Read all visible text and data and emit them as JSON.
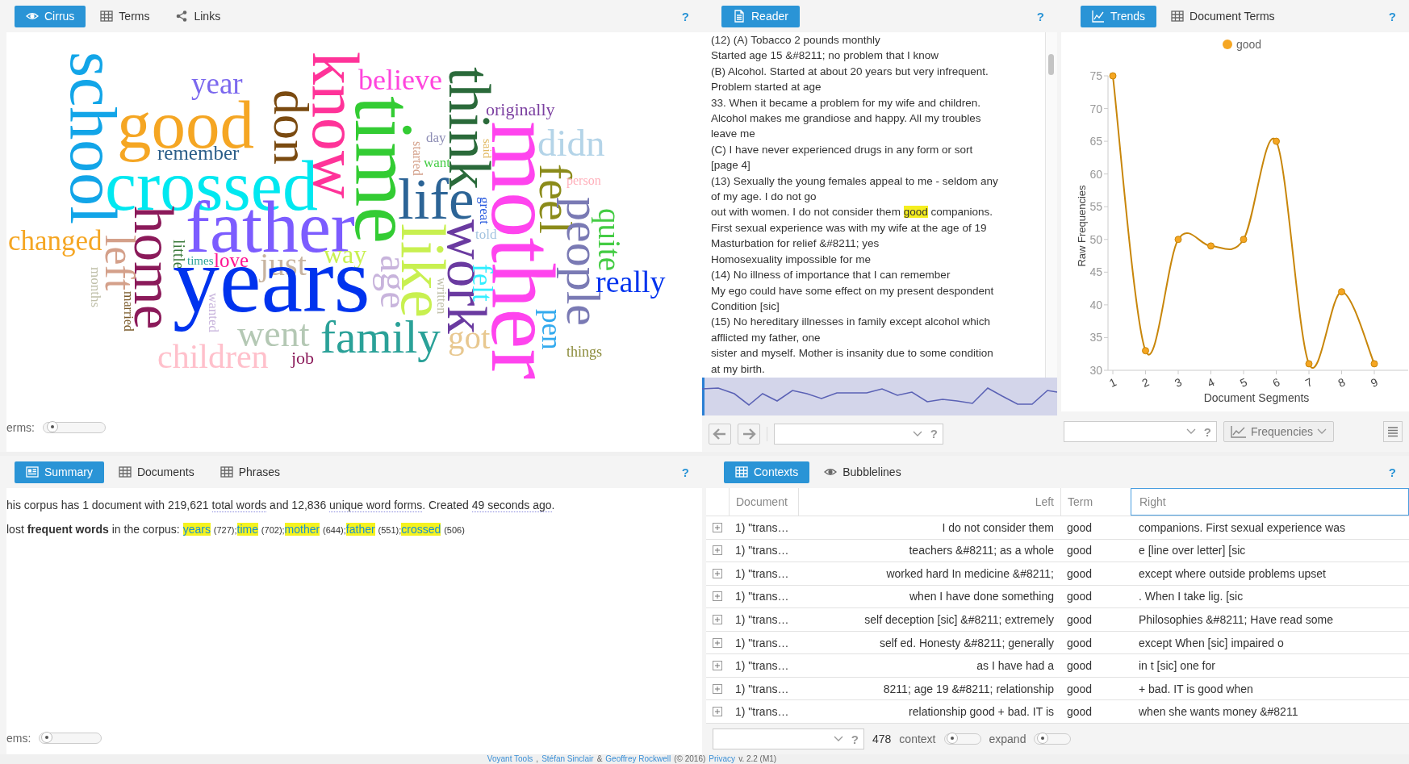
{
  "panels": {
    "cirrus": {
      "tabs": [
        {
          "label": "Cirrus",
          "selected": true
        },
        {
          "label": "Terms",
          "selected": false
        },
        {
          "label": "Links",
          "selected": false
        }
      ],
      "help": "?",
      "words": [
        {
          "text": "school",
          "color": "#12a5e8",
          "vertical": true
        },
        {
          "text": "know",
          "color": "#ff3399",
          "vertical": true
        },
        {
          "text": "think",
          "color": "#2a6a3a",
          "vertical": true
        },
        {
          "text": "year",
          "color": "#7b68ee",
          "vertical": false
        },
        {
          "text": "believe",
          "color": "#ff44dd",
          "vertical": false
        },
        {
          "text": "don",
          "color": "#7a4a10",
          "vertical": true
        },
        {
          "text": "time",
          "color": "#33cc33",
          "vertical": true
        },
        {
          "text": "good",
          "color": "#f5a623",
          "vertical": false
        },
        {
          "text": "originally",
          "color": "#7b3fa0",
          "vertical": false
        },
        {
          "text": "mother",
          "color": "#ff44ee",
          "vertical": true
        },
        {
          "text": "day",
          "color": "#8c8cb4",
          "vertical": false
        },
        {
          "text": "said",
          "color": "#e0b860",
          "vertical": true
        },
        {
          "text": "started",
          "color": "#d4a08a",
          "vertical": true
        },
        {
          "text": "remember",
          "color": "#2c5f8a",
          "vertical": false
        },
        {
          "text": "didn",
          "color": "#b4d4e8",
          "vertical": false
        },
        {
          "text": "crossed",
          "color": "#00e8f0",
          "vertical": false
        },
        {
          "text": "want",
          "color": "#44cc44",
          "vertical": false
        },
        {
          "text": "feel",
          "color": "#8b8b1a",
          "vertical": true
        },
        {
          "text": "life",
          "color": "#2c6496",
          "vertical": false
        },
        {
          "text": "person",
          "color": "#ffb0bb",
          "vertical": false
        },
        {
          "text": "great",
          "color": "#2255dd",
          "vertical": true
        },
        {
          "text": "people",
          "color": "#7a7ab4",
          "vertical": true
        },
        {
          "text": "changed",
          "color": "#f5a623",
          "vertical": false
        },
        {
          "text": "father",
          "color": "#7c5cff",
          "vertical": false
        },
        {
          "text": "home",
          "color": "#8b1a5a",
          "vertical": true
        },
        {
          "text": "quite",
          "color": "#44cc44",
          "vertical": true
        },
        {
          "text": "work",
          "color": "#6a3aa0",
          "vertical": true
        },
        {
          "text": "like",
          "color": "#c8f050",
          "vertical": true
        },
        {
          "text": "told",
          "color": "#a4c4e0",
          "vertical": false
        },
        {
          "text": "left",
          "color": "#d4a08a",
          "vertical": true
        },
        {
          "text": "little",
          "color": "#3a7a3a",
          "vertical": true
        },
        {
          "text": "times",
          "color": "#2aa198",
          "vertical": false
        },
        {
          "text": "love",
          "color": "#ff1493",
          "vertical": false
        },
        {
          "text": "just",
          "color": "#c8b4a0",
          "vertical": false
        },
        {
          "text": "way",
          "color": "#c8f050",
          "vertical": false
        },
        {
          "text": "age",
          "color": "#c8b4dc",
          "vertical": true
        },
        {
          "text": "felt",
          "color": "#33eeff",
          "vertical": true
        },
        {
          "text": "months",
          "color": "#c0c0aa",
          "vertical": true
        },
        {
          "text": "years",
          "color": "#0033ee",
          "vertical": false
        },
        {
          "text": "really",
          "color": "#0033ee",
          "vertical": false
        },
        {
          "text": "written",
          "color": "#c0c0aa",
          "vertical": true
        },
        {
          "text": "married",
          "color": "#7a5a2a",
          "vertical": true
        },
        {
          "text": "wanted",
          "color": "#c8b4dc",
          "vertical": true
        },
        {
          "text": "pen",
          "color": "#33aaee",
          "vertical": true
        },
        {
          "text": "children",
          "color": "#ffc0cb",
          "vertical": false
        },
        {
          "text": "went",
          "color": "#b4c8b4",
          "vertical": false
        },
        {
          "text": "job",
          "color": "#8b1a5a",
          "vertical": false
        },
        {
          "text": "family",
          "color": "#2aa198",
          "vertical": false
        },
        {
          "text": "got",
          "color": "#e8c890",
          "vertical": false
        },
        {
          "text": "things",
          "color": "#8b8b3a",
          "vertical": false
        }
      ],
      "slider": {
        "label": "erms:",
        "level": 0.06
      }
    },
    "reader": {
      "tabs": [
        {
          "label": "Reader",
          "selected": true
        }
      ],
      "help": "?",
      "lines": [
        {
          "kind": "text",
          "text": "(12) (A) Tobacco 2 pounds monthly"
        },
        {
          "kind": "text",
          "text": "Started age 15 &#8211; no problem that I know"
        },
        {
          "kind": "text",
          "text": "(B) Alcohol. Started at about 20 years but very infrequent."
        },
        {
          "kind": "text",
          "text": "Problem started at age"
        },
        {
          "kind": "text",
          "text": "33. When it became a problem for my wife and children."
        },
        {
          "kind": "text",
          "text": "Alcohol makes me grandiose and happy. All my troubles"
        },
        {
          "kind": "text",
          "text": "leave me"
        },
        {
          "kind": "text",
          "text": "(C) I have never experienced drugs in any form or sort"
        },
        {
          "kind": "text",
          "text": "[page 4]"
        },
        {
          "kind": "text",
          "text": "(13) Sexually the young females appeal to me - seldom any"
        },
        {
          "kind": "text",
          "text": "of my age. I do not go"
        },
        {
          "kind": "hit",
          "before": "out with women. I do not consider them ",
          "term": "good",
          "after": " companions."
        },
        {
          "kind": "text",
          "text": "First sexual experience was with my wife at the age of 19"
        },
        {
          "kind": "text",
          "text": "Masturbation for relief &#8211; yes"
        },
        {
          "kind": "text",
          "text": "Homosexuality impossible for me"
        },
        {
          "kind": "text",
          "text": "(14) No illness of importance that I can remember"
        },
        {
          "kind": "text",
          "text": "My ego could have some effect on my present despondent"
        },
        {
          "kind": "text",
          "text": "Condition [sic]"
        },
        {
          "kind": "text",
          "text": "(15) No hereditary illnesses in family except alcohol which"
        },
        {
          "kind": "text",
          "text": "afflicted my father, one"
        },
        {
          "kind": "text",
          "text": "sister and myself. Mother is insanity due to some condition"
        },
        {
          "kind": "text",
          "text": "at my birth."
        }
      ],
      "toolbar": {
        "help": "?"
      }
    },
    "trends": {
      "tabs": [
        {
          "label": "Trends",
          "selected": true
        },
        {
          "label": "Document Terms",
          "selected": false
        }
      ],
      "help": "?",
      "chart_data": {
        "type": "line",
        "xlabel": "Document Segments",
        "ylabel": "Raw Frequencies",
        "categories": [
          "1",
          "2",
          "3",
          "4",
          "5",
          "6",
          "7",
          "8",
          "9"
        ],
        "series": [
          {
            "name": "good",
            "color": "#f5a623",
            "marker": true,
            "values": [
              75,
              33,
              50,
              49,
              50,
              65,
              31,
              42,
              31
            ]
          }
        ],
        "ylim": [
          30,
          75
        ],
        "yticks": [
          30,
          35,
          40,
          45,
          50,
          55,
          60,
          65,
          70,
          75
        ]
      },
      "toolbar": {
        "help": "?",
        "button": "Frequencies"
      }
    },
    "summary": {
      "tabs": [
        {
          "label": "Summary",
          "selected": true
        },
        {
          "label": "Documents",
          "selected": false
        },
        {
          "label": "Phrases",
          "selected": false
        }
      ],
      "help": "?",
      "stats": [
        {
          "text": "his corpus has 1 document with 219,621 ",
          "dotted": false
        },
        {
          "text": "total words",
          "dotted": true
        },
        {
          "text": " and 12,836 ",
          "dotted": false
        },
        {
          "text": "unique word forms",
          "dotted": true
        },
        {
          "text": ". Created ",
          "dotted": false
        },
        {
          "text": "49 seconds ago",
          "dotted": true
        },
        {
          "text": ".",
          "dotted": false
        }
      ],
      "frequent_intro": "lost **frequent words** in the corpus: ",
      "frequent": [
        {
          "word": "years",
          "count": "(727);"
        },
        {
          "word": "time",
          "count": "(702);"
        },
        {
          "word": "mother",
          "count": "(644);"
        },
        {
          "word": "father",
          "count": "(551);"
        },
        {
          "word": "crossed",
          "count": "(506)"
        }
      ],
      "slider": {
        "label": "ems:",
        "level": 0.03
      }
    },
    "contexts": {
      "tabs": [
        {
          "label": "Contexts",
          "selected": true
        },
        {
          "label": "Bubblelines",
          "selected": false
        }
      ],
      "help": "?",
      "columns": [
        "Document",
        "Left",
        "Term",
        "Right"
      ],
      "rows": [
        {
          "document": "1) \"trans…",
          "left": "I do not consider them",
          "term": "good",
          "right": "companions. First sexual experience was"
        },
        {
          "document": "1) \"trans…",
          "left": "teachers &#8211; as a whole",
          "term": "good",
          "right": "e [line over letter] [sic"
        },
        {
          "document": "1) \"trans…",
          "left": "worked hard In medicine &#8211;",
          "term": "good",
          "right": "except where outside problems upset"
        },
        {
          "document": "1) \"trans…",
          "left": "when I have done something",
          "term": "good",
          "right": ". When I take lig. [sic"
        },
        {
          "document": "1) \"trans…",
          "left": "self deception [sic] &#8211; extremely",
          "term": "good",
          "right": "Philosophies &#8211; Have read some"
        },
        {
          "document": "1) \"trans…",
          "left": "self ed. Honesty &#8211; generally",
          "term": "good",
          "right": "except When [sic] impaired o"
        },
        {
          "document": "1) \"trans…",
          "left": "as I have had a",
          "term": "good",
          "right": "in t [sic] one for"
        },
        {
          "document": "1) \"trans…",
          "left": "8211; age 19 &#8211; relationship",
          "term": "good",
          "right": "+ bad. IT is good when"
        },
        {
          "document": "1) \"trans…",
          "left": "relationship good + bad. IT is",
          "term": "good",
          "right": "when she wants money &#8211"
        }
      ],
      "toolbar": {
        "help": "?",
        "count": "478",
        "context": {
          "label": "context",
          "level": 0.08
        },
        "expand": {
          "label": "expand",
          "level": 0.08
        }
      }
    }
  },
  "footer": [
    {
      "text": "Voyant Tools",
      "link": true
    },
    {
      "text": ",",
      "link": false
    },
    {
      "text": "Stéfan Sinclair",
      "link": true
    },
    {
      "text": "&",
      "link": false
    },
    {
      "text": "Geoffrey Rockwell",
      "link": true
    },
    {
      "text": "(© 2016)",
      "link": false
    },
    {
      "text": "Privacy",
      "link": true
    },
    {
      "text": "v. 2.2 (M1)",
      "link": false
    }
  ]
}
